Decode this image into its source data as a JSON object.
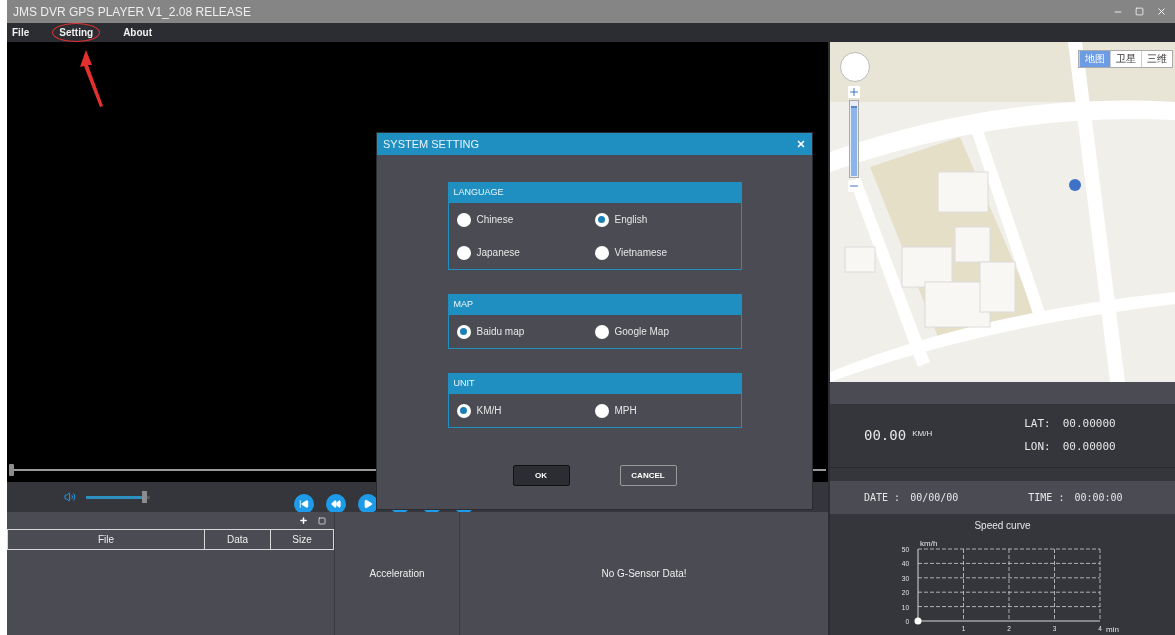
{
  "window": {
    "title": "JMS DVR GPS PLAYER V1_2.08 RELEASE"
  },
  "menu": [
    {
      "label": "File",
      "annotated": false
    },
    {
      "label": "Setting",
      "annotated": true
    },
    {
      "label": "About",
      "annotated": false
    }
  ],
  "seek": {
    "level": 0
  },
  "volume": {
    "level": 0.95
  },
  "file_list": {
    "columns": [
      "File",
      "Data",
      "Size"
    ]
  },
  "acceleration": {
    "label": "Acceleration",
    "message": "No G-Sensor Data!"
  },
  "map": {
    "kind": "picture",
    "zoom": {
      "level": 0.95
    },
    "map_types": [
      {
        "label": "地图",
        "selected": true
      },
      {
        "label": "卫星",
        "selected": false
      },
      {
        "label": "三维",
        "selected": false
      }
    ]
  },
  "gps": {
    "speed": "00.00",
    "speed_unit": "KM/H",
    "lat_label": "LAT:",
    "lat": "00.00000",
    "lon_label": "LON:",
    "lon": "00.00000",
    "date_label": "DATE :",
    "date": "00/00/00",
    "time_label": "TIME :",
    "time": "00:00:00"
  },
  "speed_chart": {
    "chart_data": {
      "type": "scatter",
      "title": "Speed curve",
      "xlabel": "min",
      "ylabel": "km/h",
      "x": [
        0
      ],
      "grid": true,
      "series": [
        {
          "color": "#ffffff",
          "values": [
            0
          ]
        }
      ],
      "xlim": [
        0,
        4
      ],
      "ylim": [
        0,
        50
      ],
      "xticks": [
        1,
        2,
        3,
        4
      ],
      "yticks": [
        0,
        10,
        20,
        30,
        40,
        50
      ]
    }
  },
  "dialog": {
    "title": "SYSTEM SETTING",
    "sections": [
      {
        "title": "LANGUAGE",
        "options": [
          {
            "label": "Chinese",
            "selected": false
          },
          {
            "label": "English",
            "selected": true
          },
          {
            "label": "Japanese",
            "selected": false
          },
          {
            "label": "Vietnamese",
            "selected": false
          }
        ]
      },
      {
        "title": "MAP",
        "options": [
          {
            "label": "Baidu map",
            "selected": true
          },
          {
            "label": "Google Map",
            "selected": false
          }
        ]
      },
      {
        "title": "UNIT",
        "options": [
          {
            "label": "KM/H",
            "selected": true
          },
          {
            "label": "MPH",
            "selected": false
          }
        ]
      }
    ],
    "buttons": [
      {
        "label": "OK",
        "default": true
      },
      {
        "label": "CANCEL",
        "default": false
      }
    ]
  }
}
